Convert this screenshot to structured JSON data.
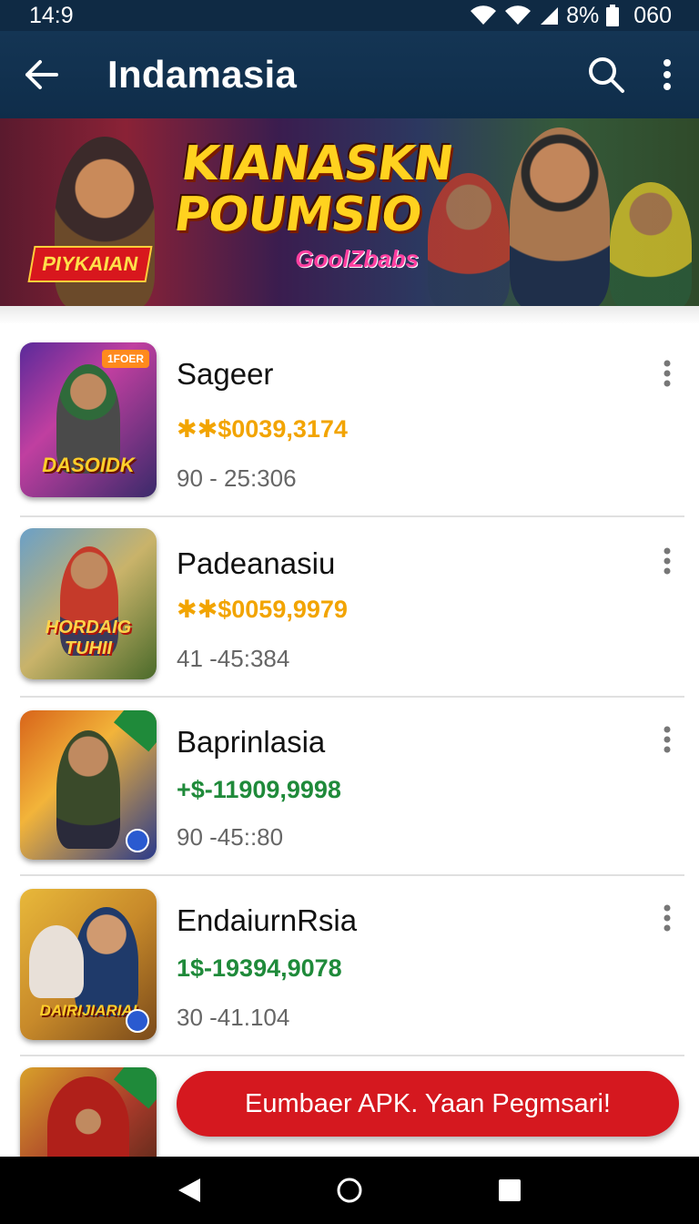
{
  "status_bar": {
    "time": "14:9",
    "battery_text": "8%",
    "right_text": "060"
  },
  "app_bar": {
    "title": "Indamasia",
    "icons": [
      "back-arrow-icon",
      "search-icon",
      "more-vert-icon"
    ]
  },
  "banner": {
    "title": "KIANASKN POUMSIO",
    "ribbon": "PIYKAIAN",
    "subtitle": "GoolZbabs"
  },
  "list": [
    {
      "name": "Sageer",
      "price": "$0039,3174",
      "price_prefix": "✱✱",
      "meta": "90 - 25:306",
      "thumb_label": "DASOIDK",
      "thumb_badge": "1FOER",
      "price_color": "#2a8a3a"
    },
    {
      "name": "Padeanasiu",
      "price": "$0059,9979",
      "price_prefix": "✱✱",
      "meta": "41 -45:384",
      "thumb_label": "HORDAIG TUHII",
      "thumb_badge": "",
      "price_color": "#f2a400"
    },
    {
      "name": "Baprinlasia",
      "price": "$-11909,9998",
      "price_prefix": "+",
      "meta": "90 -45::80",
      "thumb_label": "",
      "thumb_badge": "",
      "price_color": "#1f8a3a"
    },
    {
      "name": "EndaiurnRsia",
      "price": "1$-19394,9078",
      "price_prefix": "",
      "meta": "30 -41.104",
      "thumb_label": "DAIRIJIARIAI",
      "thumb_badge": "",
      "price_color": "#1f8a3a"
    }
  ],
  "cta": {
    "label": "Eumbaer APK. Yaan Pegmsari!"
  },
  "nav_bar": {
    "icons": [
      "nav-back-icon",
      "nav-home-icon",
      "nav-recents-icon"
    ]
  }
}
